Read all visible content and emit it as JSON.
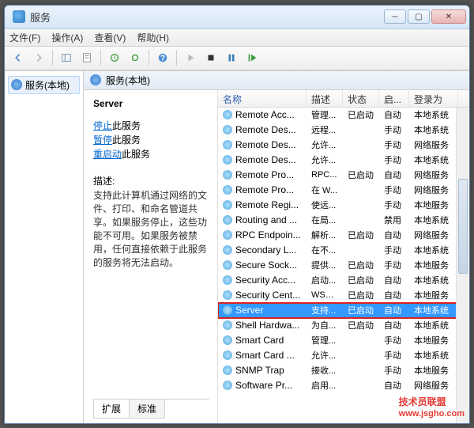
{
  "window": {
    "title": "服务"
  },
  "menubar": [
    "文件(F)",
    "操作(A)",
    "查看(V)",
    "帮助(H)"
  ],
  "nav": {
    "label": "服务(本地)"
  },
  "mainHeader": "服务(本地)",
  "detail": {
    "title": "Server",
    "link_stop": "停止",
    "link_stop_suffix": "此服务",
    "link_pause": "暂停",
    "link_pause_suffix": "此服务",
    "link_restart": "重启动",
    "link_restart_suffix": "此服务",
    "desc_label": "描述:",
    "desc": "支持此计算机通过网络的文件、打印、和命名管道共享。如果服务停止，这些功能不可用。如果服务被禁用，任何直接依赖于此服务的服务将无法启动。"
  },
  "tabs": {
    "extended": "扩展",
    "standard": "标准"
  },
  "columns": {
    "name": "名称",
    "desc": "描述",
    "status": "状态",
    "startup": "启...",
    "logon": "登录为"
  },
  "services": [
    {
      "name": "Remote Acc...",
      "desc": "管理...",
      "status": "已启动",
      "startup": "自动",
      "logon": "本地系统"
    },
    {
      "name": "Remote Des...",
      "desc": "远程...",
      "status": "",
      "startup": "手动",
      "logon": "本地系统"
    },
    {
      "name": "Remote Des...",
      "desc": "允许...",
      "status": "",
      "startup": "手动",
      "logon": "网络服务"
    },
    {
      "name": "Remote Des...",
      "desc": "允许...",
      "status": "",
      "startup": "手动",
      "logon": "本地系统"
    },
    {
      "name": "Remote Pro...",
      "desc": "RPC...",
      "status": "已启动",
      "startup": "自动",
      "logon": "网络服务"
    },
    {
      "name": "Remote Pro...",
      "desc": "在 W...",
      "status": "",
      "startup": "手动",
      "logon": "网络服务"
    },
    {
      "name": "Remote Regi...",
      "desc": "使远...",
      "status": "",
      "startup": "手动",
      "logon": "本地服务"
    },
    {
      "name": "Routing and ...",
      "desc": "在局...",
      "status": "",
      "startup": "禁用",
      "logon": "本地系统"
    },
    {
      "name": "RPC Endpoin...",
      "desc": "解析...",
      "status": "已启动",
      "startup": "自动",
      "logon": "网络服务"
    },
    {
      "name": "Secondary L...",
      "desc": "在不...",
      "status": "",
      "startup": "手动",
      "logon": "本地系统"
    },
    {
      "name": "Secure Sock...",
      "desc": "提供...",
      "status": "已启动",
      "startup": "手动",
      "logon": "本地服务"
    },
    {
      "name": "Security Acc...",
      "desc": "启动...",
      "status": "已启动",
      "startup": "自动",
      "logon": "本地系统"
    },
    {
      "name": "Security Cent...",
      "desc": "WSC...",
      "status": "已启动",
      "startup": "自动",
      "logon": "本地服务"
    },
    {
      "name": "Server",
      "desc": "支持...",
      "status": "已启动",
      "startup": "自动",
      "logon": "本地系统",
      "selected": true
    },
    {
      "name": "Shell Hardwa...",
      "desc": "为自...",
      "status": "已启动",
      "startup": "自动",
      "logon": "本地系统"
    },
    {
      "name": "Smart Card",
      "desc": "管理...",
      "status": "",
      "startup": "手动",
      "logon": "本地服务"
    },
    {
      "name": "Smart Card ...",
      "desc": "允许...",
      "status": "",
      "startup": "手动",
      "logon": "本地系统"
    },
    {
      "name": "SNMP Trap",
      "desc": "接收...",
      "status": "",
      "startup": "手动",
      "logon": "本地服务"
    },
    {
      "name": "Software Pr...",
      "desc": "启用...",
      "status": "",
      "startup": "自动",
      "logon": "网络服务"
    }
  ],
  "watermark": {
    "line1": "技术员联盟",
    "line2": "www.jsgho.com"
  }
}
